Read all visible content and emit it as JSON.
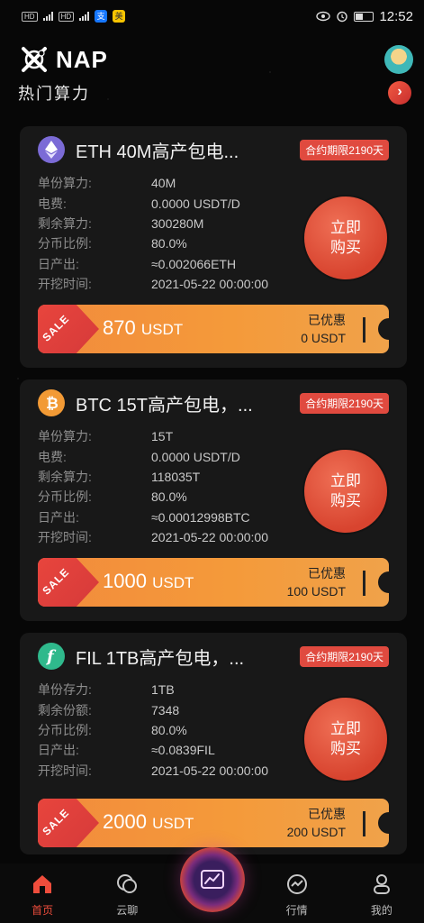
{
  "status_bar": {
    "time": "12:52",
    "app_badges": [
      "支",
      "美"
    ]
  },
  "header": {
    "app_name": "NAP"
  },
  "section": {
    "title": "热门算力",
    "more_glyph": "›"
  },
  "products": [
    {
      "coin": "ETH",
      "icon": "eth-icon",
      "icon_color": "#7b6bd6",
      "title": "ETH 40M高产包电...",
      "contract": "合约期限2190天",
      "specs": [
        {
          "label": "单份算力:",
          "value": "40M"
        },
        {
          "label": "电费:",
          "value": "0.0000 USDT/D"
        },
        {
          "label": "剩余算力:",
          "value": "300280M"
        },
        {
          "label": "分币比例:",
          "value": "80.0%"
        },
        {
          "label": "日产出:",
          "value": "≈0.002066ETH"
        },
        {
          "label": "开挖时间:",
          "value": "2021-05-22 00:00:00"
        }
      ],
      "buy_line1": "立即",
      "buy_line2": "购买",
      "sale": "SALE",
      "price_amount": "870",
      "price_unit": "USDT",
      "discount_label": "已优惠",
      "discount_value": "0 USDT"
    },
    {
      "coin": "BTC",
      "icon": "btc-icon",
      "icon_color": "#f29a35",
      "title": "BTC 15T高产包电，...",
      "contract": "合约期限2190天",
      "specs": [
        {
          "label": "单份算力:",
          "value": "15T"
        },
        {
          "label": "电费:",
          "value": "0.0000 USDT/D"
        },
        {
          "label": "剩余算力:",
          "value": "118035T"
        },
        {
          "label": "分币比例:",
          "value": "80.0%"
        },
        {
          "label": "日产出:",
          "value": "≈0.00012998BTC"
        },
        {
          "label": "开挖时间:",
          "value": "2021-05-22 00:00:00"
        }
      ],
      "buy_line1": "立即",
      "buy_line2": "购买",
      "sale": "SALE",
      "price_amount": "1000",
      "price_unit": "USDT",
      "discount_label": "已优惠",
      "discount_value": "100 USDT"
    },
    {
      "coin": "FIL",
      "icon": "fil-icon",
      "icon_color": "#2fb98c",
      "title": "FIL 1TB高产包电，...",
      "contract": "合约期限2190天",
      "specs": [
        {
          "label": "单份存力:",
          "value": "1TB"
        },
        {
          "label": "剩余份额:",
          "value": "7348"
        },
        {
          "label": "分币比例:",
          "value": "80.0%"
        },
        {
          "label": "日产出:",
          "value": "≈0.0839FIL"
        },
        {
          "label": "开挖时间:",
          "value": "2021-05-22 00:00:00"
        }
      ],
      "buy_line1": "立即",
      "buy_line2": "购买",
      "sale": "SALE",
      "price_amount": "2000",
      "price_unit": "USDT",
      "discount_label": "已优惠",
      "discount_value": "200 USDT"
    }
  ],
  "nav": {
    "home": "首页",
    "chat": "云聊",
    "market": "行情",
    "mine": "我的"
  },
  "colors": {
    "accent": "#ef4d3c",
    "price_bar": "#f49a3a",
    "card_bg": "#181818"
  }
}
